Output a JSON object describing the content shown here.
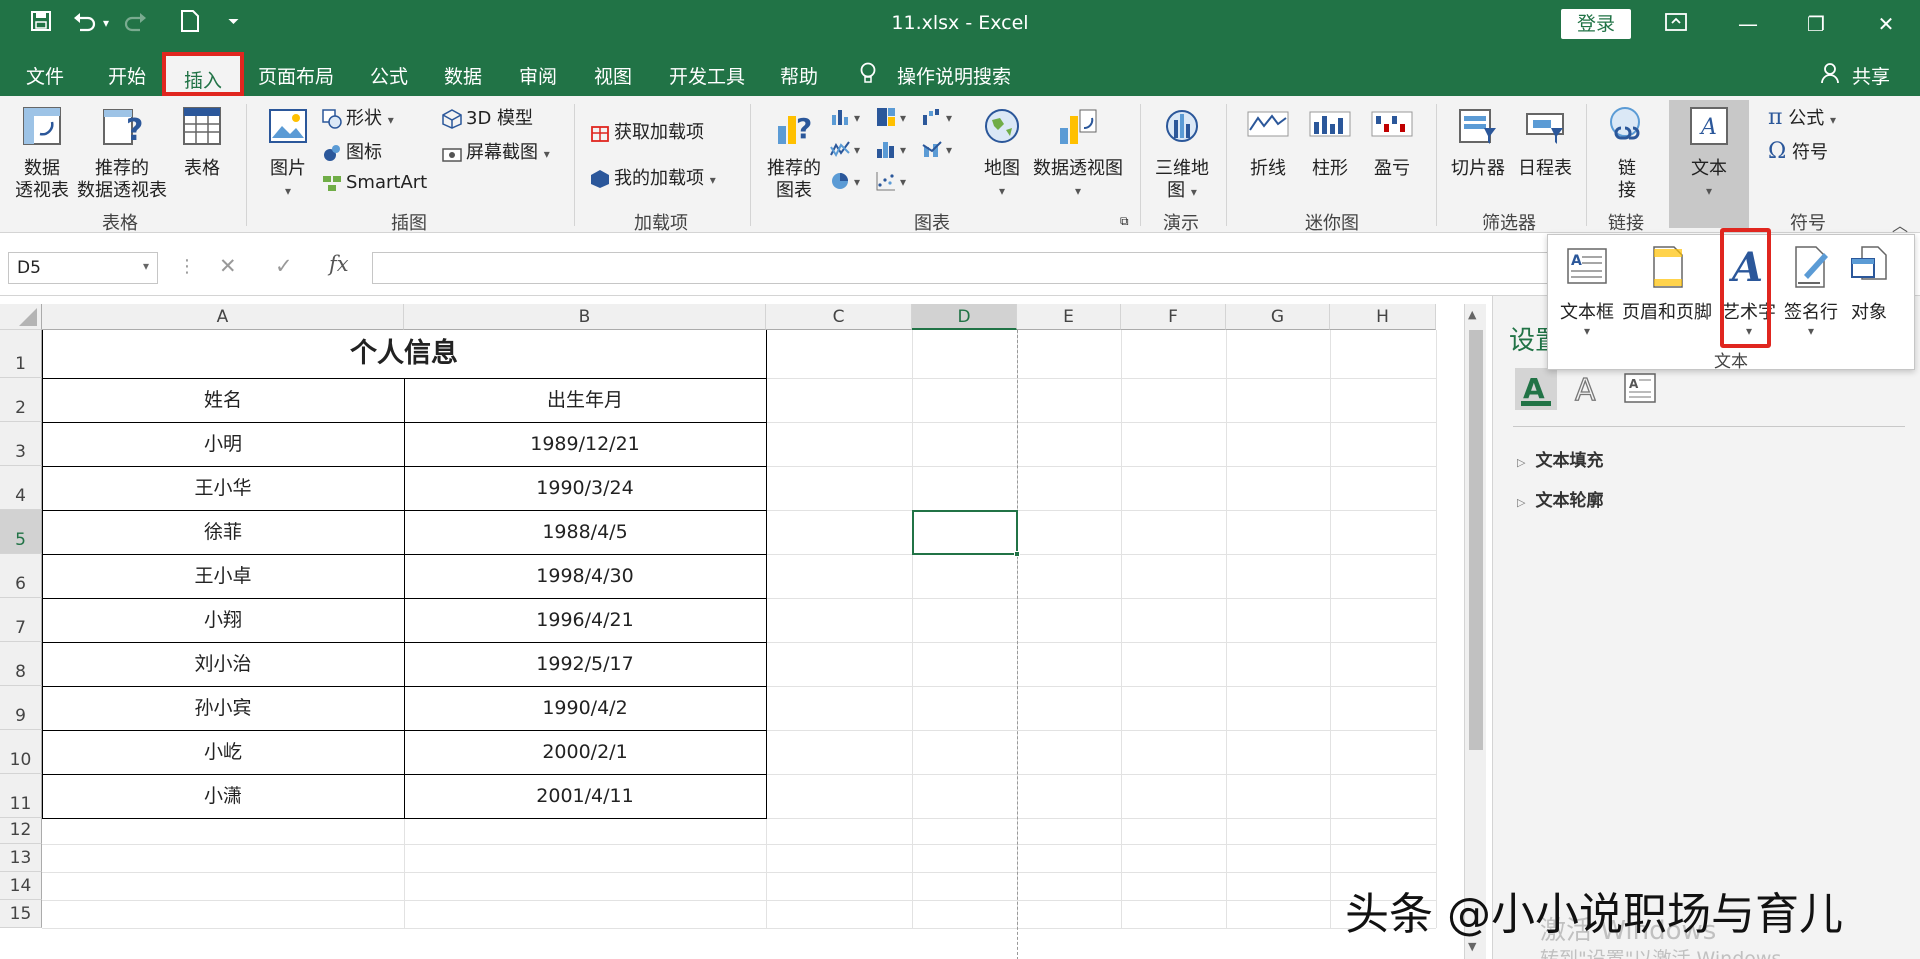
{
  "title_bar": {
    "title": "11.xlsx  -  Excel",
    "login_label": "登录"
  },
  "tabs": [
    "文件",
    "开始",
    "插入",
    "页面布局",
    "公式",
    "数据",
    "审阅",
    "视图",
    "开发工具",
    "帮助"
  ],
  "active_tab": "插入",
  "tell_me": "操作说明搜索",
  "share_label": "共享",
  "ribbon": {
    "groups": {
      "tables": "表格",
      "illustrations": "插图",
      "addins": "加载项",
      "charts": "图表",
      "tours": "演示",
      "sparklines": "迷你图",
      "filters": "筛选器",
      "links": "链接",
      "symbols": "符号"
    },
    "pivot_table": [
      "数据",
      "透视表"
    ],
    "recommended_pivot": [
      "推荐的",
      "数据透视表"
    ],
    "table": "表格",
    "pictures": "图片",
    "shapes": "形状",
    "icons": "图标",
    "smartart": "SmartArt",
    "model3d": "3D 模型",
    "screenshot": "屏幕截图",
    "get_addins": "获取加载项",
    "my_addins": "我的加载项",
    "recommended_charts": [
      "推荐的",
      "图表"
    ],
    "maps": "地图",
    "pivot_chart": "数据透视图",
    "map3d": [
      "三维地",
      "图"
    ],
    "line": "折线",
    "column": "柱形",
    "winloss": "盈亏",
    "slicer": "切片器",
    "timeline": "日程表",
    "link": [
      "链",
      "接"
    ],
    "text": "文本",
    "equation": "公式",
    "symbol": "符号"
  },
  "text_dropdown": {
    "items": [
      "文本框",
      "页眉和页脚",
      "艺术字",
      "签名行",
      "对象"
    ],
    "label": "文本"
  },
  "formula_bar": {
    "name_box": "D5",
    "fx": "fx"
  },
  "columns": [
    "A",
    "B",
    "C",
    "D",
    "E",
    "F",
    "G",
    "H"
  ],
  "rows": [
    "1",
    "2",
    "3",
    "4",
    "5",
    "6",
    "7",
    "8",
    "9",
    "10",
    "11",
    "12",
    "13",
    "14",
    "15"
  ],
  "table": {
    "title": "个人信息",
    "headers": [
      "姓名",
      "出生年月"
    ],
    "data": [
      [
        "小明",
        "1989/12/21"
      ],
      [
        "王小华",
        "1990/3/24"
      ],
      [
        "徐菲",
        "1988/4/5"
      ],
      [
        "王小卓",
        "1998/4/30"
      ],
      [
        "小翔",
        "1996/4/21"
      ],
      [
        "刘小治",
        "1992/5/17"
      ],
      [
        "孙小宾",
        "1990/4/2"
      ],
      [
        "小屹",
        "2000/2/1"
      ],
      [
        "小潇",
        "2001/4/11"
      ]
    ]
  },
  "format_pane": {
    "title": "设置",
    "sections": [
      "文本填充",
      "文本轮廓"
    ]
  },
  "overlay": {
    "watermark": "头条 @小小说职场与育儿",
    "activate_line1": "激活 Windows",
    "activate_line2": "转到\"设置\"以激活 Windows。"
  },
  "colors": {
    "excel_green": "#217346",
    "highlight_red": "#e0261f"
  }
}
